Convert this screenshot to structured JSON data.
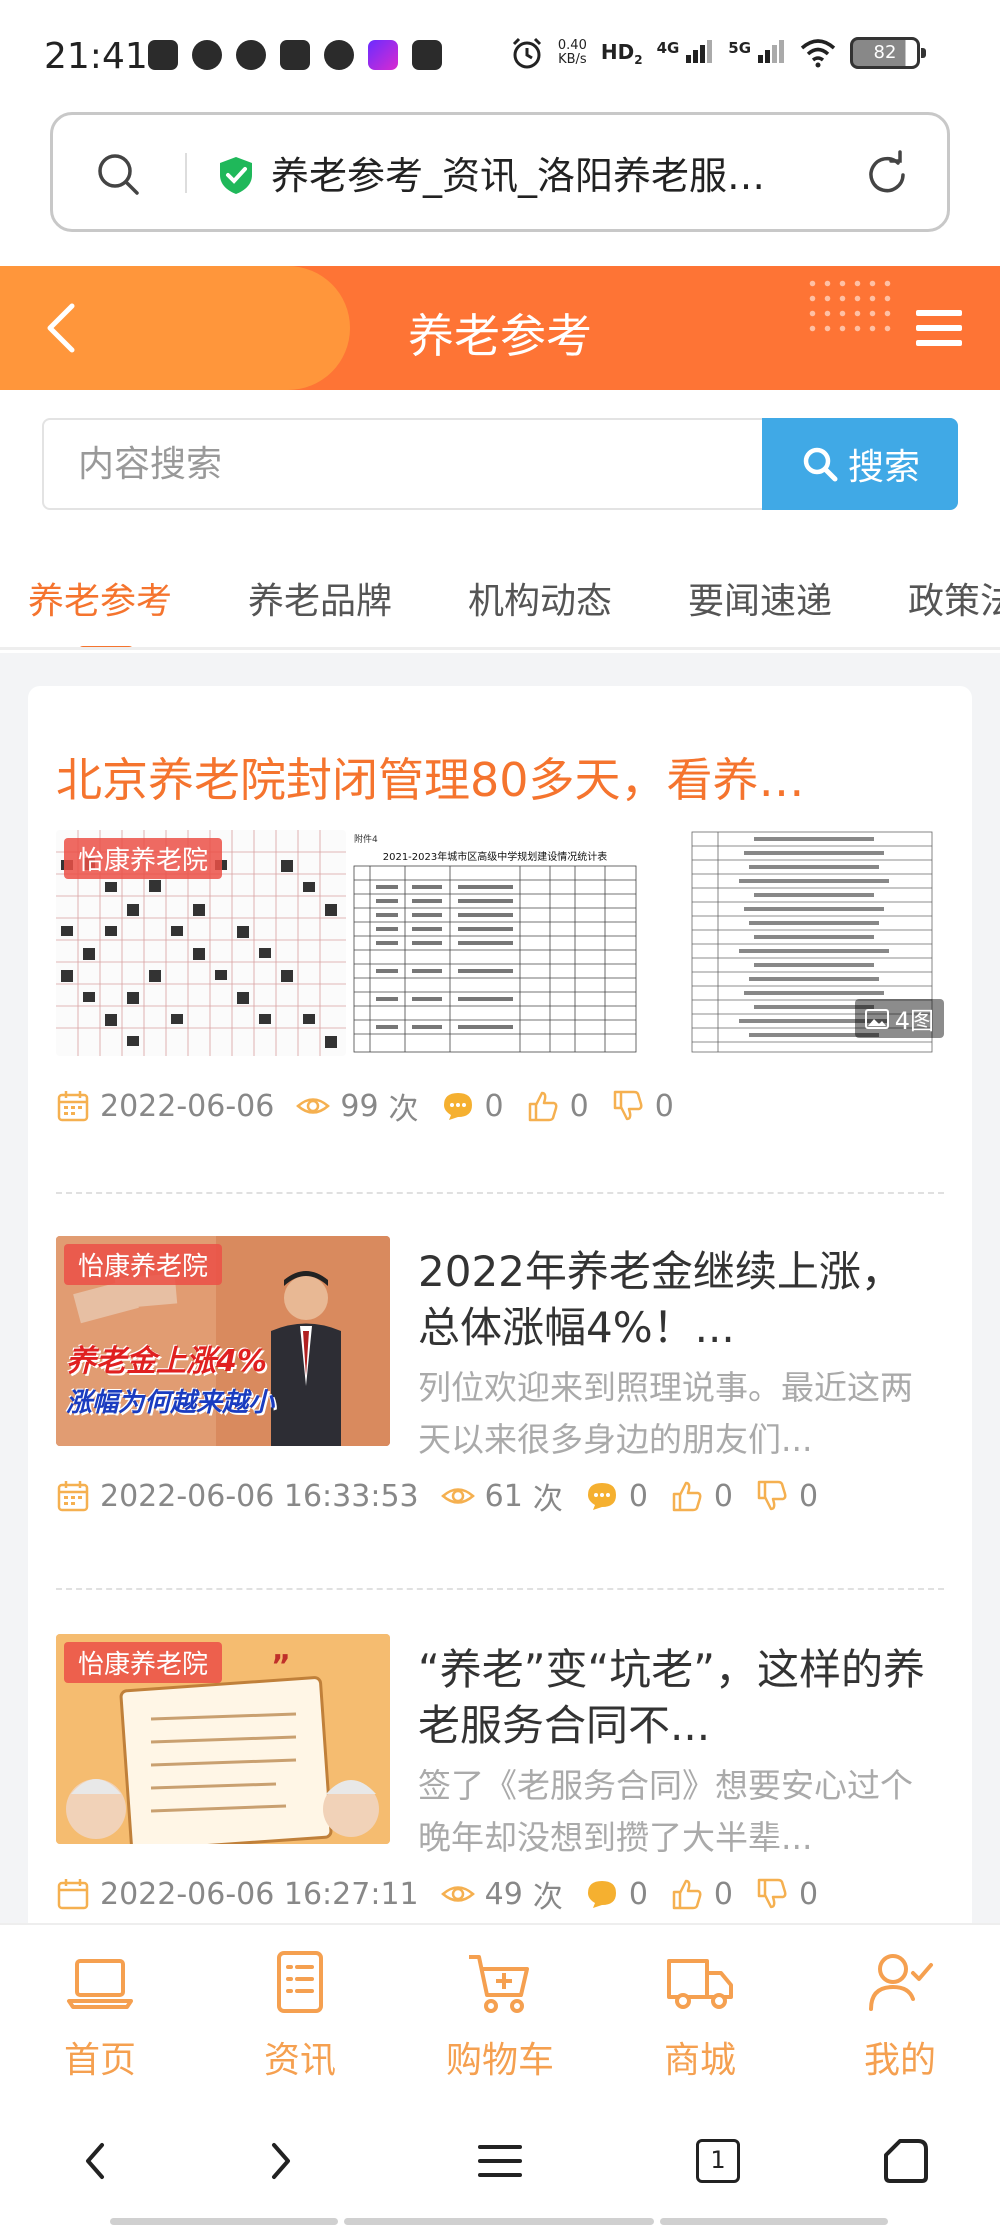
{
  "status_bar": {
    "time": "21:41",
    "net_speed_value": "0.40",
    "net_speed_unit": "KB/s",
    "hd_label": "HD",
    "hd_sub": "2",
    "signal_1": "4G",
    "signal_2": "5G",
    "battery": "82"
  },
  "browser": {
    "url_title": "养老参考_资讯_洛阳养老服…"
  },
  "header": {
    "title": "养老参考"
  },
  "search": {
    "placeholder": "内容搜索",
    "button_label": "搜索"
  },
  "tabs": [
    {
      "label": "养老参考",
      "active": true
    },
    {
      "label": "养老品牌",
      "active": false
    },
    {
      "label": "机构动态",
      "active": false
    },
    {
      "label": "要闻速递",
      "active": false
    },
    {
      "label": "政策法",
      "active": false
    }
  ],
  "articles": [
    {
      "title": "北京养老院封闭管理80多天，看养…",
      "badge": "怡康养老院",
      "image_count": "4图",
      "date": "2022-06-06",
      "views": "99",
      "views_unit": "次",
      "comments": "0",
      "likes": "0",
      "dislikes": "0"
    },
    {
      "title": "2022年养老金继续上涨，总体涨幅4%！...",
      "desc": "列位欢迎来到照理说事。最近这两天以来很多身边的朋友们...",
      "badge": "怡康养老院",
      "thumb_text_1": "养老金上涨4%",
      "thumb_text_2": "涨幅为何越来越小",
      "date": "2022-06-06 16:33:53",
      "views": "61",
      "views_unit": "次",
      "comments": "0",
      "likes": "0",
      "dislikes": "0"
    },
    {
      "title": "“养老”变“坑老”，这样的养老服务合同不...",
      "desc": "签了《老服务合同》想要安心过个晚年却没想到攒了大半辈...",
      "badge": "怡康养老院",
      "date": "2022-06-06 16:27:11",
      "views": "49",
      "views_unit": "次",
      "comments": "0",
      "likes": "0",
      "dislikes": "0"
    }
  ],
  "doc_thumb": {
    "title": "2021-2023年城市区高级中学规划建设情况统计表",
    "label": "附件4"
  },
  "bottom_nav": [
    {
      "label": "首页",
      "icon": "laptop-icon"
    },
    {
      "label": "资讯",
      "icon": "news-list-icon"
    },
    {
      "label": "购物车",
      "icon": "cart-icon"
    },
    {
      "label": "商城",
      "icon": "truck-icon"
    },
    {
      "label": "我的",
      "icon": "user-check-icon"
    }
  ],
  "browser_toolbar": {
    "tab_count": "1"
  },
  "colors": {
    "accent": "#f5742e",
    "header_bg": "#fe7435",
    "search_button": "#40a9e6",
    "nav_icon": "#f5a050"
  }
}
